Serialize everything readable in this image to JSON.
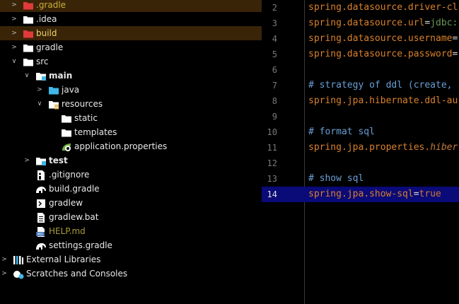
{
  "project_tree": {
    "items": [
      {
        "label": ".gradle",
        "depth": 0,
        "arrow": "right",
        "icon": "folder-excluded-icon",
        "style": "gold",
        "highlight": true
      },
      {
        "label": ".idea",
        "depth": 0,
        "arrow": "right",
        "icon": "folder-icon",
        "style": "normal",
        "highlight": false
      },
      {
        "label": "build",
        "depth": 0,
        "arrow": "right",
        "icon": "folder-excluded-icon",
        "style": "excluded",
        "highlight": true
      },
      {
        "label": "gradle",
        "depth": 0,
        "arrow": "right",
        "icon": "folder-icon",
        "style": "normal",
        "highlight": false
      },
      {
        "label": "src",
        "depth": 0,
        "arrow": "down",
        "icon": "folder-icon",
        "style": "normal",
        "highlight": false
      },
      {
        "label": "main",
        "depth": 1,
        "arrow": "down",
        "icon": "module-folder-icon",
        "style": "bold",
        "highlight": false
      },
      {
        "label": "java",
        "depth": 2,
        "arrow": "right",
        "icon": "source-folder-icon",
        "style": "normal",
        "highlight": false
      },
      {
        "label": "resources",
        "depth": 2,
        "arrow": "down",
        "icon": "resources-folder-icon",
        "style": "normal",
        "highlight": false
      },
      {
        "label": "static",
        "depth": 3,
        "arrow": "",
        "icon": "folder-icon",
        "style": "normal",
        "highlight": false
      },
      {
        "label": "templates",
        "depth": 3,
        "arrow": "",
        "icon": "folder-icon",
        "style": "normal",
        "highlight": false
      },
      {
        "label": "application.properties",
        "depth": 3,
        "arrow": "",
        "icon": "spring-properties-icon",
        "style": "normal",
        "highlight": false
      },
      {
        "label": "test",
        "depth": 1,
        "arrow": "right",
        "icon": "module-folder-icon",
        "style": "bold",
        "highlight": false
      },
      {
        "label": ".gitignore",
        "depth": 1,
        "arrow": "",
        "icon": "gitignore-file-icon",
        "style": "normal",
        "highlight": false
      },
      {
        "label": "build.gradle",
        "depth": 1,
        "arrow": "",
        "icon": "gradle-elephant-icon",
        "style": "normal",
        "highlight": false
      },
      {
        "label": "gradlew",
        "depth": 1,
        "arrow": "",
        "icon": "shell-script-icon",
        "style": "normal",
        "highlight": false
      },
      {
        "label": "gradlew.bat",
        "depth": 1,
        "arrow": "",
        "icon": "text-file-icon",
        "style": "normal",
        "highlight": false
      },
      {
        "label": "HELP.md",
        "depth": 1,
        "arrow": "",
        "icon": "markdown-file-icon",
        "style": "olive",
        "highlight": false
      },
      {
        "label": "settings.gradle",
        "depth": 1,
        "arrow": "",
        "icon": "gradle-elephant-icon",
        "style": "normal",
        "highlight": false
      },
      {
        "label": "External Libraries",
        "depth": -1,
        "arrow": "right",
        "icon": "libraries-icon",
        "style": "normal",
        "highlight": false
      },
      {
        "label": "Scratches and Consoles",
        "depth": -1,
        "arrow": "right",
        "icon": "scratches-icon",
        "style": "normal",
        "highlight": false
      }
    ]
  },
  "editor": {
    "current_line": 14,
    "lines": [
      {
        "n": 2,
        "parts": [
          [
            "key",
            "spring.datasource.driver-cl"
          ]
        ]
      },
      {
        "n": 3,
        "parts": [
          [
            "key",
            "spring.datasource.url"
          ],
          [
            "eq",
            "="
          ],
          [
            "val",
            "jdbc:"
          ]
        ]
      },
      {
        "n": 4,
        "parts": [
          [
            "key",
            "spring.datasource.username"
          ],
          [
            "eq",
            "="
          ]
        ]
      },
      {
        "n": 5,
        "parts": [
          [
            "key",
            "spring.datasource.password"
          ],
          [
            "eq",
            "="
          ]
        ]
      },
      {
        "n": 6,
        "parts": []
      },
      {
        "n": 7,
        "parts": [
          [
            "cmt",
            "# strategy of ddl (create,"
          ]
        ]
      },
      {
        "n": 8,
        "parts": [
          [
            "key",
            "spring.jpa.hibernate.ddl-au"
          ]
        ]
      },
      {
        "n": 9,
        "parts": []
      },
      {
        "n": 10,
        "parts": [
          [
            "cmt",
            "# format sql"
          ]
        ]
      },
      {
        "n": 11,
        "parts": [
          [
            "key",
            "spring.jpa.properties."
          ],
          [
            "ital",
            "hiber"
          ]
        ]
      },
      {
        "n": 12,
        "parts": []
      },
      {
        "n": 13,
        "parts": [
          [
            "cmt",
            "# show sql"
          ]
        ]
      },
      {
        "n": 14,
        "parts": [
          [
            "key",
            "spring.jpa.show-sql"
          ],
          [
            "eq",
            "="
          ],
          [
            "kw",
            "true"
          ]
        ]
      }
    ]
  },
  "colors": {
    "tree_highlight": "#3a2408",
    "current_line": "#0a0a78",
    "excluded_folder": "#e03a3a",
    "folder": "#ffffff",
    "source_folder": "#3fb7e8",
    "key": "#d9812a",
    "comment": "#6a9fd6"
  }
}
